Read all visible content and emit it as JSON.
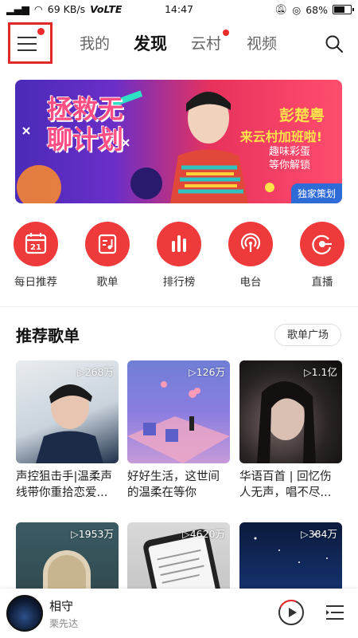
{
  "status": {
    "network_speed": "69 KB/s",
    "carrier": "VoLTE",
    "time": "14:47",
    "battery": "68%"
  },
  "nav": {
    "tabs": [
      "我的",
      "发现",
      "云村",
      "视频"
    ],
    "active_tab": "发现"
  },
  "banner": {
    "left_text": "拯救无聊计划",
    "name": "彭楚粤",
    "headline": "来云村加班啦!",
    "sub_line1": "趣味彩蛋",
    "sub_line2": "等你解锁",
    "tag": "独家策划"
  },
  "quick": [
    {
      "label": "每日推荐",
      "icon": "calendar-icon",
      "date": "21"
    },
    {
      "label": "歌单",
      "icon": "playlist-icon"
    },
    {
      "label": "排行榜",
      "icon": "chart-bars-icon"
    },
    {
      "label": "电台",
      "icon": "radio-icon"
    },
    {
      "label": "直播",
      "icon": "live-icon"
    }
  ],
  "section": {
    "title": "推荐歌单",
    "button": "歌单广场"
  },
  "playlists": [
    {
      "count": "268万",
      "title": "声控狙击手|温柔声线带你重拾恋爱..."
    },
    {
      "count": "126万",
      "title": "好好生活，这世间的温柔在等你"
    },
    {
      "count": "1.1亿",
      "title": "华语百首 | 回忆伤人无声，唱不尽..."
    },
    {
      "count": "1953万",
      "title": ""
    },
    {
      "count": "4620万",
      "title": ""
    },
    {
      "count": "384万",
      "title": ""
    }
  ],
  "player": {
    "song": "相守",
    "artist": "栗先达"
  },
  "colors": {
    "accent": "#ee3a3a",
    "highlight_box": "#e02a2a",
    "banner_tag": "#2f6bd6"
  }
}
